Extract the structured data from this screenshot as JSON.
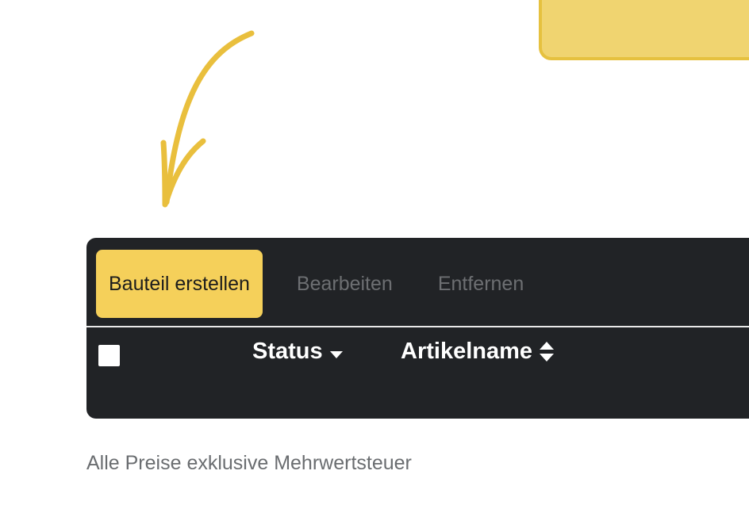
{
  "toolbar": {
    "create_label": "Bauteil erstellen",
    "edit_label": "Bearbeiten",
    "delete_label": "Entfernen"
  },
  "table": {
    "columns": [
      {
        "label": "Status",
        "sort": "descending"
      },
      {
        "label": "Artikelname",
        "sort": "unsorted"
      }
    ]
  },
  "footer": {
    "note": "Alle Preise exklusive Mehrwertsteuer"
  },
  "colors": {
    "accent": "#f5d05a",
    "panel": "#212326",
    "callout": "#f0d470",
    "arrow": "#e9bf3d"
  },
  "icons": {
    "status_sort": "caret-down-icon",
    "name_sort": "sort-up-down-icon",
    "annotation": "curved-arrow-icon"
  }
}
